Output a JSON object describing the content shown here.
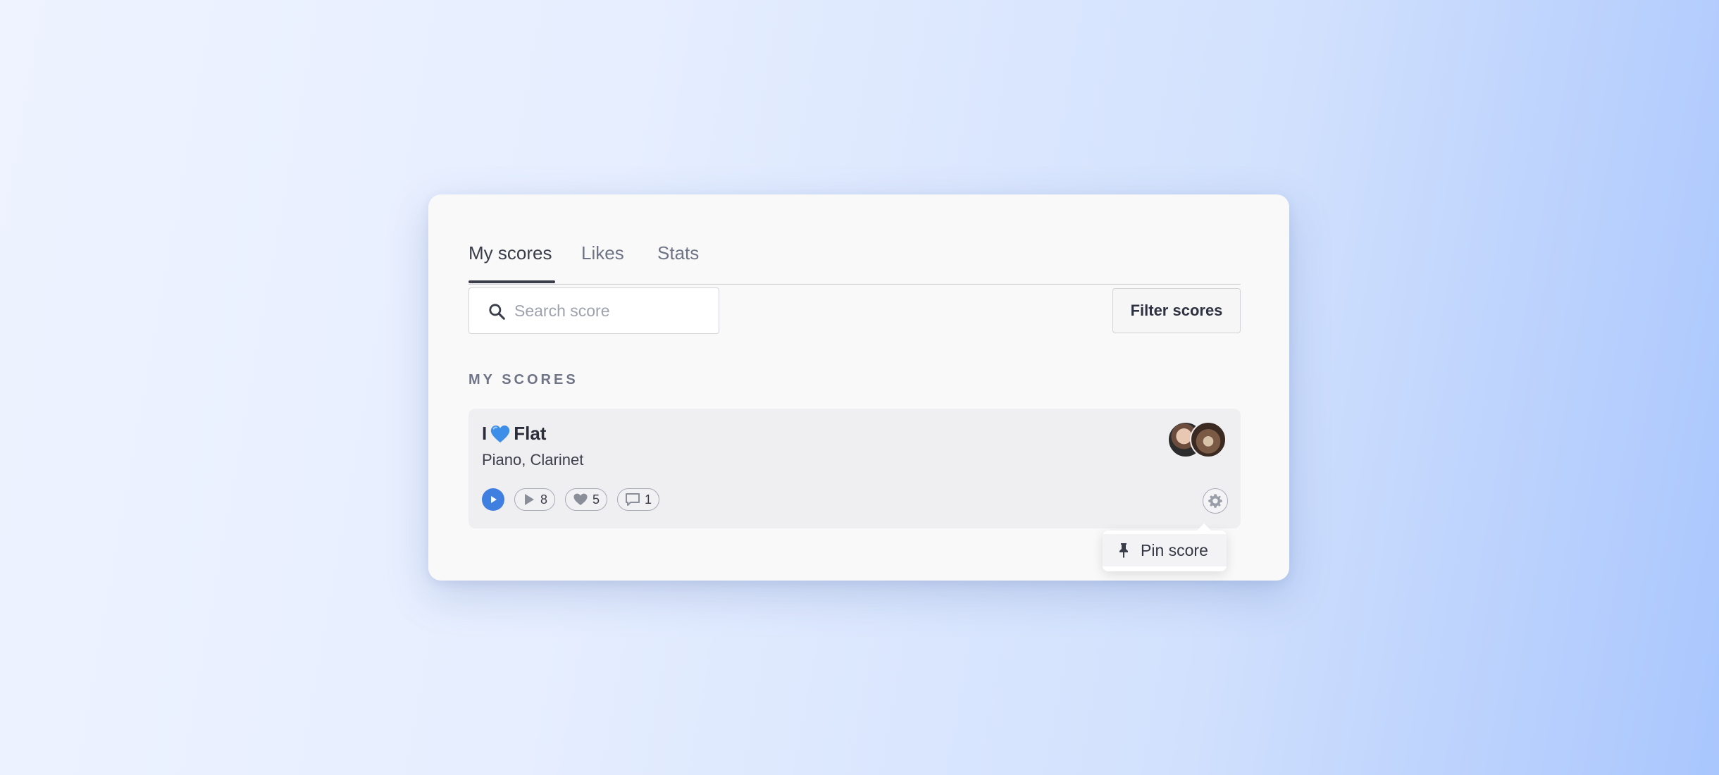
{
  "tabs": [
    {
      "label": "My scores",
      "active": true
    },
    {
      "label": "Likes",
      "active": false
    },
    {
      "label": "Stats",
      "active": false
    }
  ],
  "search": {
    "placeholder": "Search score",
    "value": ""
  },
  "filter_button": {
    "label": "Filter scores"
  },
  "section": {
    "label": "MY SCORES"
  },
  "score": {
    "title_prefix": "I",
    "title_emoji": "blue-heart",
    "title_suffix": "Flat",
    "instruments": "Piano, Clarinet",
    "plays": "8",
    "likes": "5",
    "comments": "1"
  },
  "menu": {
    "pin_label": "Pin score"
  },
  "colors": {
    "accent": "#3f7fe0",
    "text": "#2b2e3a",
    "muted": "#6f7487"
  }
}
